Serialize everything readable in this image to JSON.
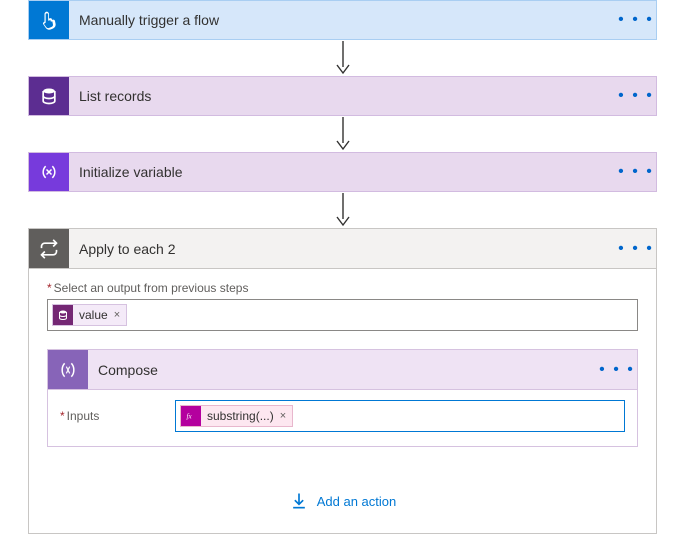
{
  "steps": {
    "trigger": {
      "title": "Manually trigger a flow"
    },
    "listRecords": {
      "title": "List records"
    },
    "initVar": {
      "title": "Initialize variable"
    },
    "applyEach": {
      "title": "Apply to each 2",
      "outputLabel": "Select an output from previous steps",
      "outputToken": "value"
    },
    "compose": {
      "title": "Compose",
      "inputsLabel": "Inputs",
      "inputToken": "substring(...)"
    }
  },
  "addAction": "Add an action",
  "menuDots": "• • •",
  "requiredMark": "*",
  "removeMark": "×"
}
